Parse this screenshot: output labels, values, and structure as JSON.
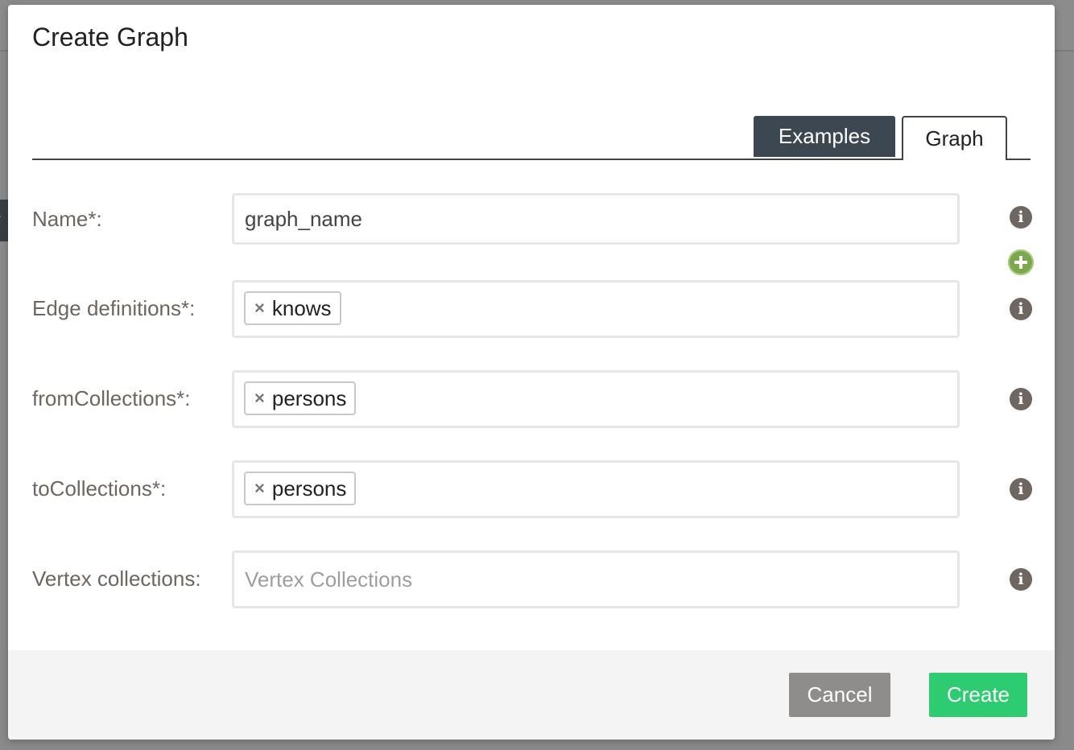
{
  "modal": {
    "title": "Create Graph",
    "tabs": [
      {
        "label": "Examples",
        "active": false
      },
      {
        "label": "Graph",
        "active": true
      }
    ]
  },
  "form": {
    "name": {
      "label": "Name*:",
      "value": "graph_name"
    },
    "edge_definitions": {
      "label": "Edge definitions*:",
      "tags": [
        "knows"
      ]
    },
    "from_collections": {
      "label": "fromCollections*:",
      "tags": [
        "persons"
      ]
    },
    "to_collections": {
      "label": "toCollections*:",
      "tags": [
        "persons"
      ]
    },
    "vertex_collections": {
      "label": "Vertex collections:",
      "value": "",
      "placeholder": "Vertex Collections"
    }
  },
  "icons": {
    "info": "info-icon",
    "add": "plus-circle-icon",
    "tag_remove": "x-icon",
    "info_glyph": "i",
    "tag_remove_glyph": "×"
  },
  "footer": {
    "cancel_label": "Cancel",
    "create_label": "Create"
  },
  "colors": {
    "tab_active_bg": "#3d4751",
    "create_button": "#2ecc71",
    "cancel_button": "#8f8d8c",
    "add_icon": "#7aa84a",
    "label_text": "#6d6661"
  }
}
